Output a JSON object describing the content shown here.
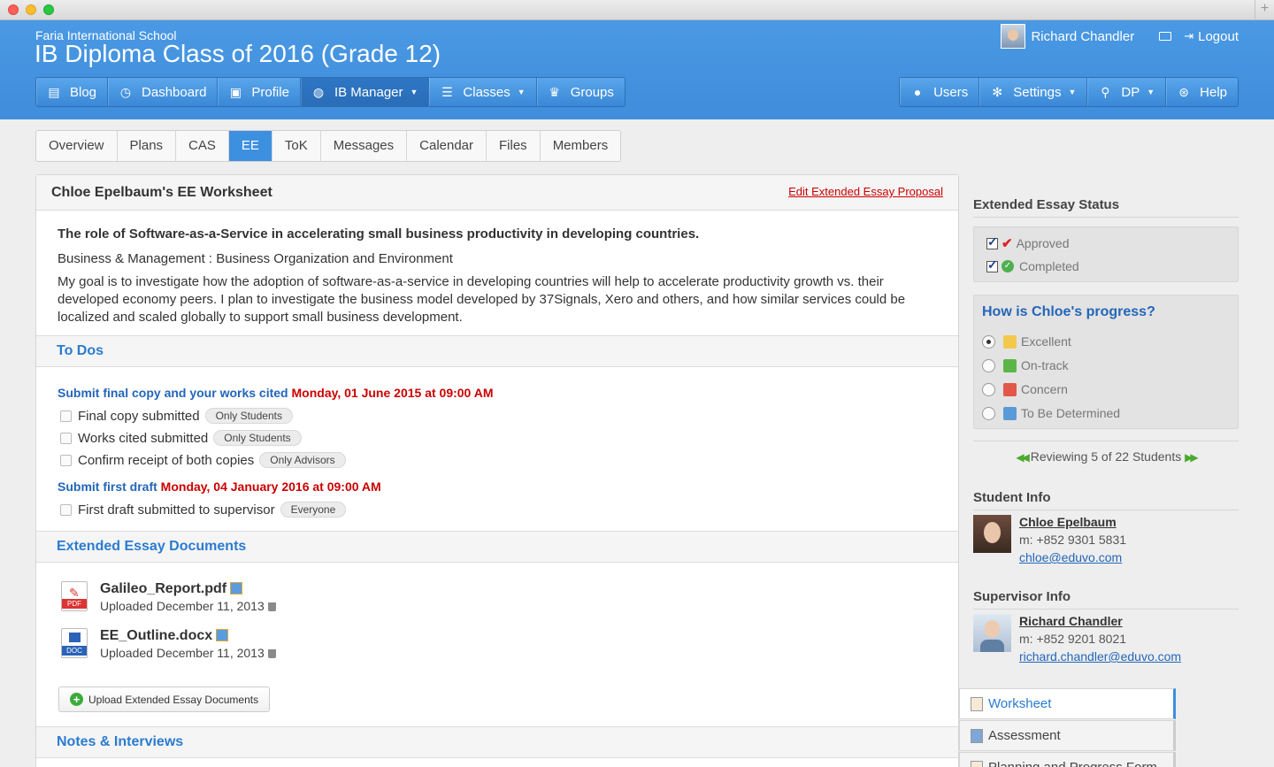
{
  "header": {
    "school": "Faria International School",
    "title": "IB Diploma Class of 2016 (Grade 12)",
    "user_name": "Richard Chandler",
    "logout": "Logout"
  },
  "nav_left": [
    {
      "label": "Blog",
      "icon": "blog-icon"
    },
    {
      "label": "Dashboard",
      "icon": "dashboard-icon"
    },
    {
      "label": "Profile",
      "icon": "profile-icon"
    },
    {
      "label": "IB Manager",
      "icon": "globe-icon",
      "active": true,
      "dropdown": true
    },
    {
      "label": "Classes",
      "icon": "classes-icon",
      "dropdown": true
    },
    {
      "label": "Groups",
      "icon": "trophy-icon"
    }
  ],
  "nav_right": [
    {
      "label": "Users",
      "icon": "user-icon"
    },
    {
      "label": "Settings",
      "icon": "gear-icon",
      "dropdown": true
    },
    {
      "label": "DP",
      "icon": "search-icon",
      "dropdown": true
    },
    {
      "label": "Help",
      "icon": "lifebuoy-icon"
    }
  ],
  "subtabs": [
    "Overview",
    "Plans",
    "CAS",
    "EE",
    "ToK",
    "Messages",
    "Calendar",
    "Files",
    "Members"
  ],
  "subtab_active": "EE",
  "worksheet": {
    "heading": "Chloe Epelbaum's EE Worksheet",
    "edit_link": "Edit Extended Essay Proposal",
    "question": "The role of Software-as-a-Service in accelerating small business productivity in developing countries.",
    "subject": "Business & Management : Business Organization and Environment",
    "goal": "My goal is to investigate how the adoption of software-as-a-service in developing countries will help to accelerate productivity growth vs. their developed economy peers. I plan to investigate the business model developed by 37Signals, Xero and others, and how similar services could be localized and scaled globally to support small business development."
  },
  "todos": {
    "heading": "To Dos",
    "groups": [
      {
        "title": "Submit final copy and your works cited",
        "due": "Monday, 01 June 2015 at 09:00 AM",
        "items": [
          {
            "label": "Final copy submitted",
            "tag": "Only Students"
          },
          {
            "label": "Works cited submitted",
            "tag": "Only Students"
          },
          {
            "label": "Confirm receipt of both copies",
            "tag": "Only Advisors"
          }
        ]
      },
      {
        "title": "Submit first draft",
        "due": "Monday, 04 January 2016 at 09:00 AM",
        "items": [
          {
            "label": "First draft submitted to supervisor",
            "tag": "Everyone"
          }
        ]
      }
    ]
  },
  "documents": {
    "heading": "Extended Essay Documents",
    "files": [
      {
        "name": "Galileo_Report.pdf",
        "uploaded": "Uploaded December 11, 2013",
        "type": "PDF"
      },
      {
        "name": "EE_Outline.docx",
        "uploaded": "Uploaded December 11, 2013",
        "type": "DOC"
      }
    ],
    "upload_label": "Upload Extended Essay Documents"
  },
  "notes": {
    "heading": "Notes & Interviews"
  },
  "status": {
    "heading": "Extended Essay Status",
    "items": [
      "Approved",
      "Completed"
    ]
  },
  "progress": {
    "heading": "How is Chloe's progress?",
    "options": [
      "Excellent",
      "On-track",
      "Concern",
      "To Be Determined"
    ],
    "selected": "Excellent",
    "reviewing": "Reviewing 5 of 22 Students"
  },
  "student": {
    "heading": "Student Info",
    "name": "Chloe Epelbaum",
    "phone": "m: +852 9301 5831",
    "email": "chloe@eduvo.com"
  },
  "supervisor": {
    "heading": "Supervisor Info",
    "name": "Richard Chandler",
    "phone": "m: +852 9201 8021",
    "email": "richard.chandler@eduvo.com"
  },
  "side_tabs": [
    "Worksheet",
    "Assessment",
    "Planning and Progress Form"
  ],
  "colors": {
    "header_blue": "#4a99e4",
    "accent": "#3d8fe0",
    "link": "#2366b9",
    "due_red": "#cc0000"
  }
}
